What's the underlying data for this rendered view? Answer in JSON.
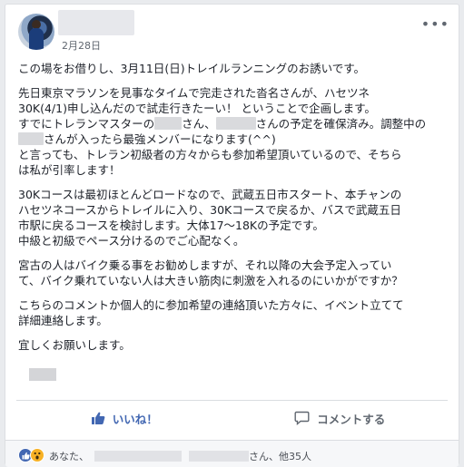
{
  "post": {
    "date": "2月28日",
    "more_label": "•••",
    "paragraphs": {
      "p1": "この場をお借りし、3月11日(日)トレイルランニングのお誘いです。",
      "p2_l1": "先日東京マラソンを見事なタイムで完走された沓名さんが、ハセツネ",
      "p2_l2": "30K(4/1)申し込んだので試走行きたーい！ ということで企画します。",
      "p2_l3a": "すでにトレランマスターの",
      "p2_l3b": "さん、",
      "p2_l3c": "さんの予定を確保済み。調整中の",
      "p2_l4": "さんが入ったら最強メンバーになります(^^)",
      "p2_l5": "と言っても、トレラン初級者の方々からも参加希望頂いているので、そちら",
      "p2_l6": "は私が引率します！",
      "p3_l1": "30Kコースは最初ほとんどロードなので、武蔵五日市スタート、本チャンの",
      "p3_l2": "ハセツネコースからトレイルに入り、30Kコースで戻るか、バスで武蔵五日",
      "p3_l3": "市駅に戻るコースを検討します。大体17〜18Kの予定です。",
      "p3_l4": "中級と初級でペース分けるのでご心配なく。",
      "p4_l1": "宮古の人はバイク乗る事をお勧めしますが、それ以降の大会予定入ってい",
      "p4_l2": "て、バイク乗れていない人は大きい筋肉に刺激を入れるのにいかがですか？",
      "p5_l1": "こちらのコメントか個人的に参加希望の連絡頂いた方々に、イベント立てて",
      "p5_l2": "詳細連絡します。",
      "p6": "宜しくお願いします。"
    }
  },
  "actions": {
    "like_label": "いいね！",
    "comment_label": "コメントする"
  },
  "footer": {
    "prefix": "あなた、",
    "suffix": "さん、他35人"
  },
  "icons": {
    "like": "thumbs-up-icon",
    "comment": "speech-bubble-icon",
    "more": "more-dots-icon",
    "reaction_like": "like-reaction-icon",
    "reaction_wow": "wow-reaction-icon"
  },
  "colors": {
    "accent": "#4267b2",
    "wow": "#f7b125",
    "text": "#1d2129",
    "muted": "#606770"
  }
}
